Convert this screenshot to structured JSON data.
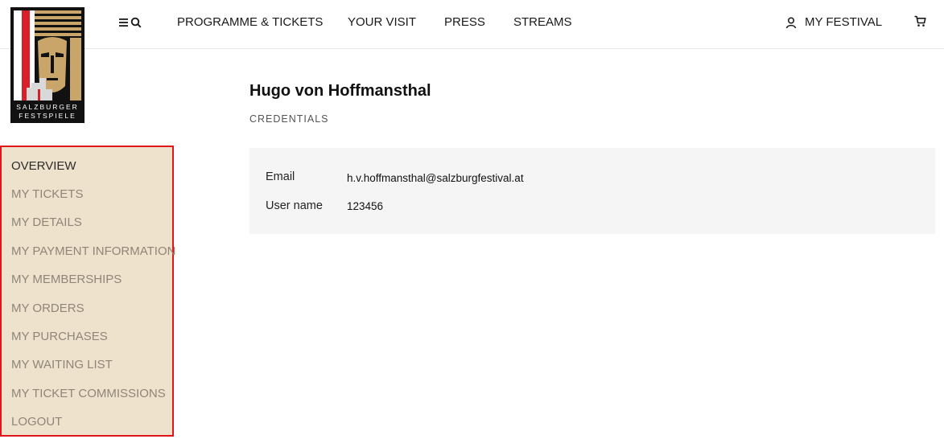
{
  "header": {
    "logo_text_line1": "SALZBURGER",
    "logo_text_line2": "FESTSPIELE",
    "nav": [
      {
        "label": "PROGRAMME & TICKETS"
      },
      {
        "label": "YOUR VISIT"
      },
      {
        "label": "PRESS"
      },
      {
        "label": "STREAMS"
      }
    ],
    "my_festival_label": "MY FESTIVAL"
  },
  "sidebar": {
    "items": [
      {
        "label": "OVERVIEW",
        "active": true
      },
      {
        "label": "MY TICKETS"
      },
      {
        "label": "MY DETAILS"
      },
      {
        "label": "MY PAYMENT INFORMATION"
      },
      {
        "label": "MY MEMBERSHIPS"
      },
      {
        "label": "MY ORDERS"
      },
      {
        "label": "MY PURCHASES"
      },
      {
        "label": "MY WAITING LIST"
      },
      {
        "label": "MY TICKET COMMISSIONS"
      },
      {
        "label": "LOGOUT"
      }
    ]
  },
  "main": {
    "user_name": "Hugo von Hoffmansthal",
    "section_label": "CREDENTIALS",
    "credentials": [
      {
        "label": "Email",
        "value": "h.v.hoffmansthal@salzburgfestival.at"
      },
      {
        "label": "User name",
        "value": "123456"
      }
    ]
  },
  "colors": {
    "sidebar_bg": "#efe2cd",
    "sidebar_border": "#e0161b",
    "panel_bg": "#f5f5f5",
    "logo_red": "#d8202a",
    "logo_gold": "#c9a56a"
  }
}
